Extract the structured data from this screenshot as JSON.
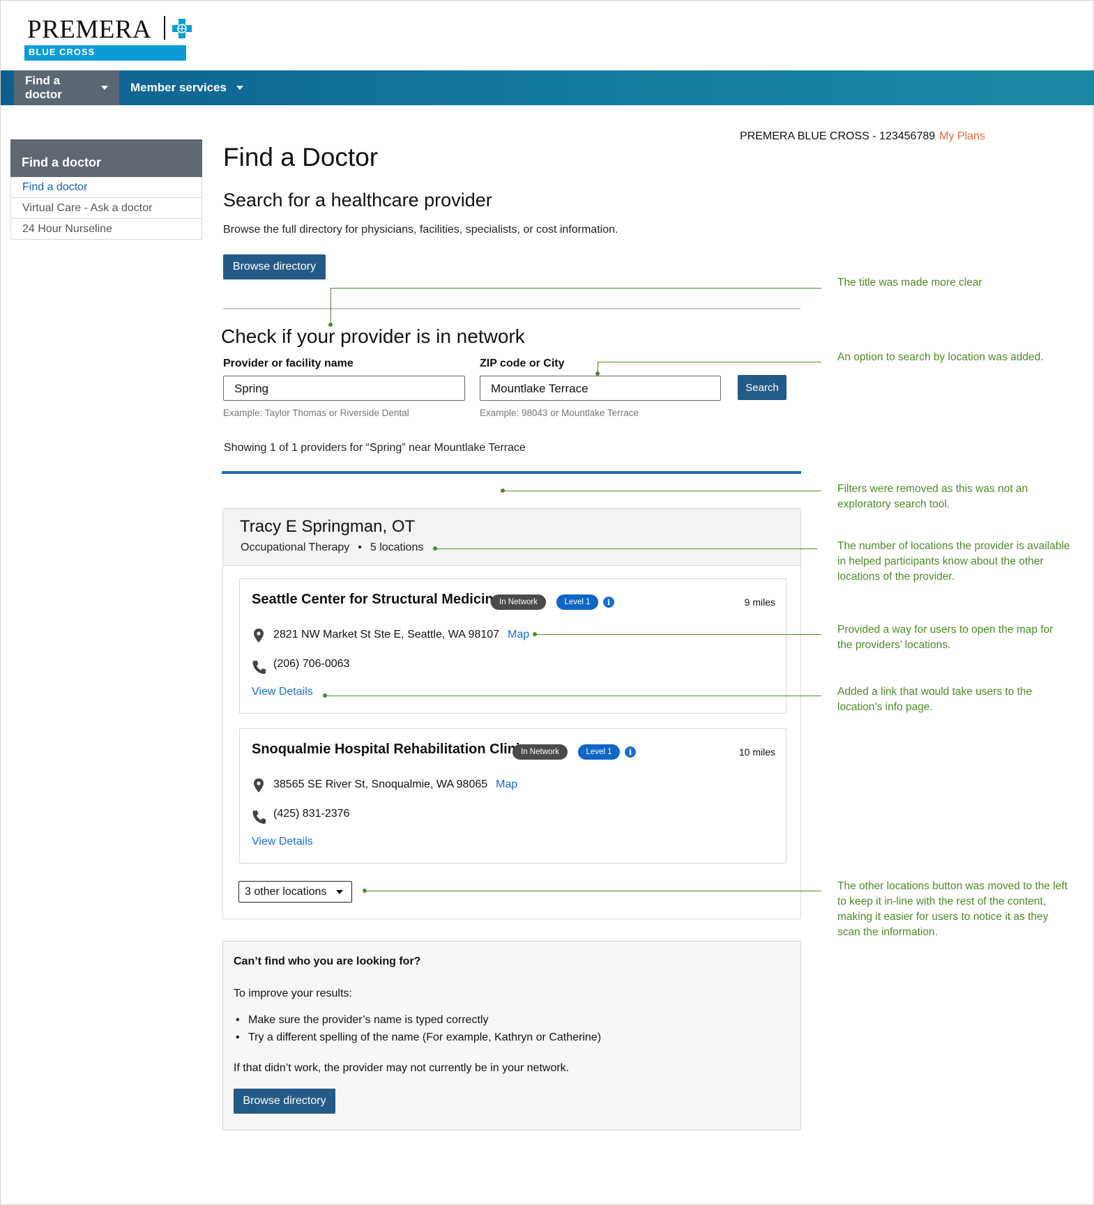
{
  "brand": {
    "name": "PREMERA",
    "sub": "BLUE CROSS",
    "accent": "#0b9bd7"
  },
  "nav": {
    "items": [
      {
        "label": "Find a doctor"
      },
      {
        "label": "Member services"
      }
    ]
  },
  "sidebar": {
    "heading": "Find a doctor",
    "items": [
      {
        "label": "Find a doctor"
      },
      {
        "label": "Virtual Care - Ask a doctor"
      },
      {
        "label": "24 Hour Nurseline"
      }
    ]
  },
  "plan": {
    "text": "PREMERA BLUE CROSS - 123456789",
    "link": "My Plans"
  },
  "page": {
    "title": "Find a Doctor",
    "subtitle": "Search for a healthcare provider",
    "lead": "Browse the full directory for physicians, facilities, specialists, or cost information.",
    "browse_label": "Browse directory"
  },
  "network_check": {
    "title": "Check if your provider is in network",
    "name_label": "Provider or facility name",
    "name_value": "Spring",
    "name_hint": "Example: Taylor Thomas or Riverside Dental",
    "location_label": "ZIP code or City",
    "location_value": "Mountlake Terrace",
    "location_hint": "Example: 98043 or Mountlake Terrace",
    "search_label": "Search",
    "showing": "Showing 1 of 1 providers for “Spring” near Mountlake Terrace"
  },
  "provider": {
    "name": "Tracy E Springman, OT",
    "specialty": "Occupational Therapy",
    "bullet": "•",
    "locations_count": "5 locations",
    "locations": [
      {
        "name": "Seattle Center for Structural Medicine",
        "network": "In Network",
        "level": "Level 1",
        "distance": "9 miles",
        "address": "2821 NW Market St Ste E, Seattle, WA 98107",
        "map": "Map",
        "phone": "(206) 706-0063",
        "details": "View Details"
      },
      {
        "name": "Snoqualmie Hospital Rehabilitation Clinic",
        "network": "In Network",
        "level": "Level 1",
        "distance": "10 miles",
        "address": "38565 SE River St, Snoqualmie, WA 98065",
        "map": "Map",
        "phone": "(425) 831-2376",
        "details": "View Details"
      }
    ],
    "other_locations": "3 other locations"
  },
  "help": {
    "title": "Can’t find who you are looking for?",
    "intro": "To improve your results:",
    "bullet": "•",
    "tips": [
      "Make sure the provider’s name is typed correctly",
      "Try a different spelling of the name (For example, Kathryn or Catherine)"
    ],
    "outro": "If that didn’t work, the provider may not currently be in your network.",
    "browse_label": "Browse directory"
  },
  "annotations": [
    {
      "text": "The title was made more clear"
    },
    {
      "text": "An option to search by location was added."
    },
    {
      "text": "Filters were removed as this was not an exploratory search tool."
    },
    {
      "text": "The number of locations the provider is available in helped participants know about the other locations of the provider."
    },
    {
      "text": "Provided a way for users to open the map for the providers’ locations."
    },
    {
      "text": "Added a link that would take users to the location’s info page."
    },
    {
      "text": "The other locations button was moved to the left to keep it in-line with the rest of the content, making it easier for users to notice it as they scan the information."
    }
  ],
  "colors": {
    "nav_start": "#0f5f8e",
    "nav_end": "#1a8aa3",
    "button": "#245a87",
    "link": "#1a6ed0",
    "plan_link": "#e86a3a",
    "annotation": "#4e8a2a",
    "in_network_pill": "#4a4a4a",
    "level_pill": "#0f66c6"
  },
  "icons": [
    "blue-cross-logo-icon",
    "caret-down-icon",
    "location-pin-icon",
    "phone-icon",
    "info-icon"
  ]
}
